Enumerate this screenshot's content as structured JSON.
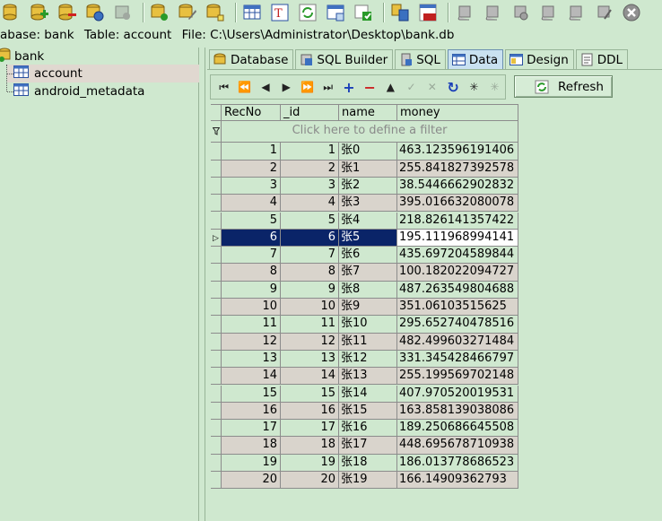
{
  "pathbar": {
    "database_label": "abase: bank",
    "table_label": "Table: account",
    "file_label": "File: C:\\Users\\Administrator\\Desktop\\bank.db"
  },
  "tree": {
    "root": "bank",
    "items": [
      "account",
      "android_metadata"
    ],
    "selected": "account"
  },
  "tabs": [
    {
      "label": "Database",
      "icon": "database-icon"
    },
    {
      "label": "SQL Builder",
      "icon": "sql-builder-icon"
    },
    {
      "label": "SQL",
      "icon": "sql-icon"
    },
    {
      "label": "Data",
      "icon": "data-grid-icon",
      "active": true
    },
    {
      "label": "Design",
      "icon": "design-icon"
    },
    {
      "label": "DDL",
      "icon": "ddl-icon"
    }
  ],
  "navigator": {
    "buttons": [
      "first",
      "prior-page",
      "prior",
      "next",
      "next-page",
      "last",
      "insert",
      "delete",
      "edit",
      "post",
      "cancel",
      "refresh",
      "apply-updates",
      "cancel-updates"
    ],
    "glyphs": [
      "⏮",
      "⏪",
      "◀",
      "▶",
      "⏩",
      "⏭",
      "+",
      "−",
      "▲",
      "✓",
      "✕",
      "↻",
      "✳",
      "✳"
    ]
  },
  "refresh_label": "Refresh",
  "grid": {
    "columns": [
      "RecNo",
      "_id",
      "name",
      "money"
    ],
    "filter_placeholder": "Click here to define a filter",
    "selected_recno": 6,
    "rows": [
      {
        "recno": "1",
        "id": "1",
        "name": "张0",
        "money": "463.123596191406"
      },
      {
        "recno": "2",
        "id": "2",
        "name": "张1",
        "money": "255.841827392578"
      },
      {
        "recno": "3",
        "id": "3",
        "name": "张2",
        "money": "38.5446662902832"
      },
      {
        "recno": "4",
        "id": "4",
        "name": "张3",
        "money": "395.016632080078"
      },
      {
        "recno": "5",
        "id": "5",
        "name": "张4",
        "money": "218.826141357422"
      },
      {
        "recno": "6",
        "id": "6",
        "name": "张5",
        "money": "195.111968994141"
      },
      {
        "recno": "7",
        "id": "7",
        "name": "张6",
        "money": "435.697204589844"
      },
      {
        "recno": "8",
        "id": "8",
        "name": "张7",
        "money": "100.182022094727"
      },
      {
        "recno": "9",
        "id": "9",
        "name": "张8",
        "money": "487.263549804688"
      },
      {
        "recno": "10",
        "id": "10",
        "name": "张9",
        "money": "351.06103515625"
      },
      {
        "recno": "11",
        "id": "11",
        "name": "张10",
        "money": "295.652740478516"
      },
      {
        "recno": "12",
        "id": "12",
        "name": "张11",
        "money": "482.499603271484"
      },
      {
        "recno": "13",
        "id": "13",
        "name": "张12",
        "money": "331.345428466797"
      },
      {
        "recno": "14",
        "id": "14",
        "name": "张13",
        "money": "255.199569702148"
      },
      {
        "recno": "15",
        "id": "15",
        "name": "张14",
        "money": "407.970520019531"
      },
      {
        "recno": "16",
        "id": "16",
        "name": "张15",
        "money": "163.858139038086"
      },
      {
        "recno": "17",
        "id": "17",
        "name": "张16",
        "money": "189.250686645508"
      },
      {
        "recno": "18",
        "id": "18",
        "name": "张17",
        "money": "448.695678710938"
      },
      {
        "recno": "19",
        "id": "19",
        "name": "张18",
        "money": "186.013778686523"
      },
      {
        "recno": "20",
        "id": "20",
        "name": "张19",
        "money": "166.14909362793"
      }
    ]
  },
  "colors": {
    "background": "#cfe8cf",
    "selection": "#0a2468",
    "alt_row": "#d9d4cc"
  }
}
